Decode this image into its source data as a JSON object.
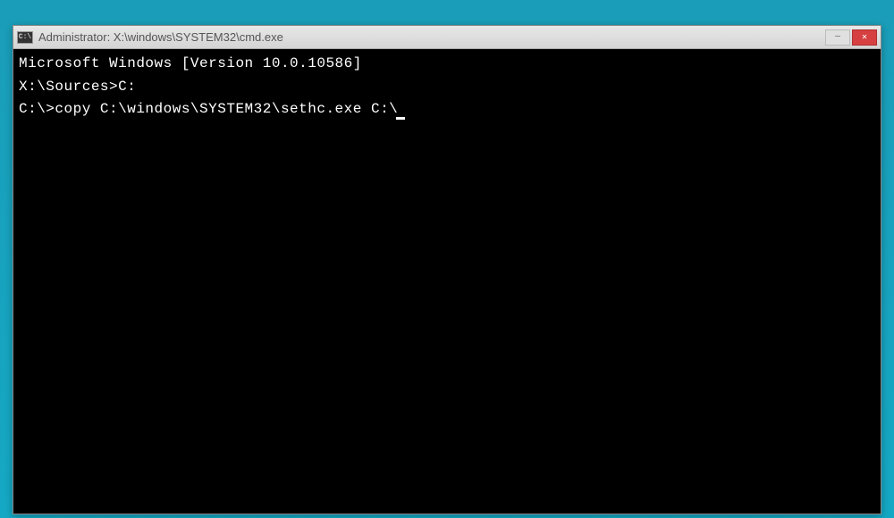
{
  "window": {
    "title": "Administrator: X:\\windows\\SYSTEM32\\cmd.exe",
    "icon_label": "C:\\"
  },
  "terminal": {
    "line1": "Microsoft Windows [Version 10.0.10586]",
    "line2": "",
    "line3": "X:\\Sources>C:",
    "line4": "",
    "prompt": "C:\\>",
    "command": "copy C:\\windows\\SYSTEM32\\sethc.exe C:\\"
  }
}
